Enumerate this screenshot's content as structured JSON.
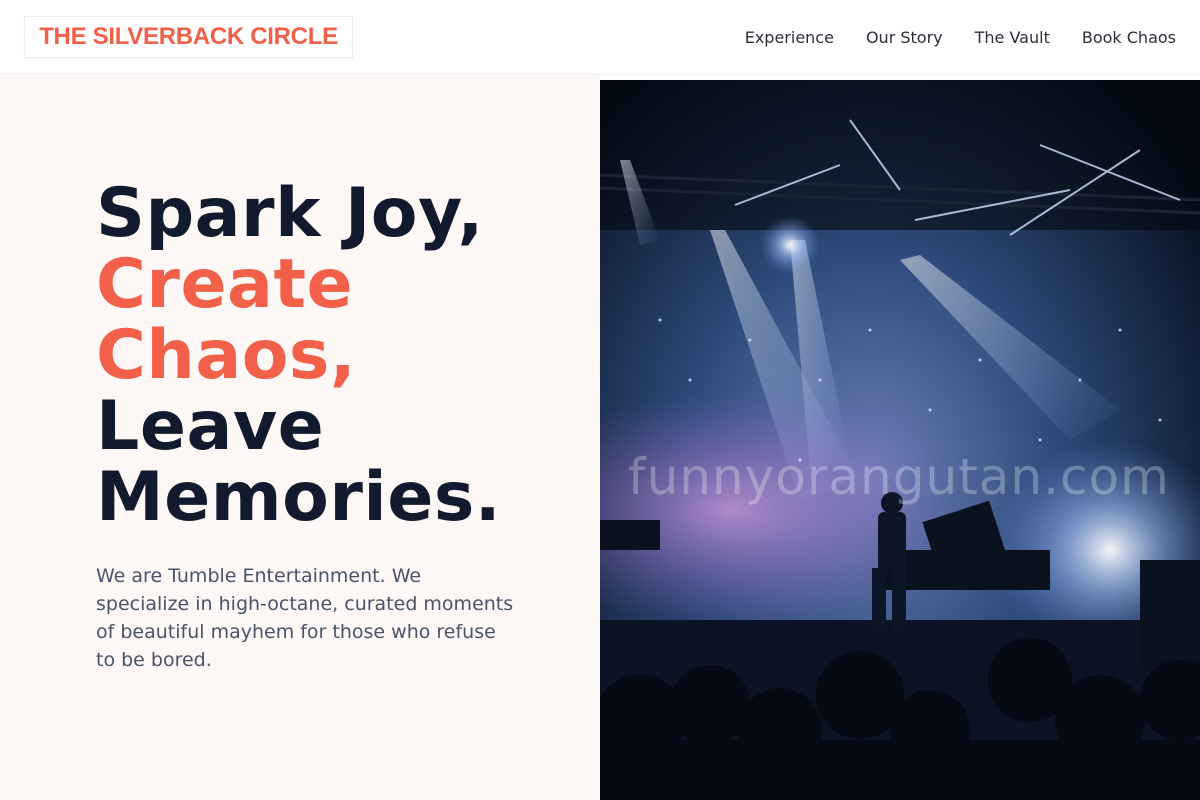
{
  "brand": {
    "logo_text": "THE SILVERBACK CIRCLE",
    "accent_color": "#f2604a"
  },
  "nav": {
    "items": [
      {
        "label": "Experience"
      },
      {
        "label": "Our Story"
      },
      {
        "label": "The Vault"
      },
      {
        "label": "Book Chaos"
      }
    ]
  },
  "hero": {
    "headline": {
      "line1": "Spark Joy,",
      "line2": "Create",
      "line3": "Chaos,",
      "line4": "Leave",
      "line5": "Memories."
    },
    "description": "We are Tumble Entertainment. We specialize in high-octane, curated moments of beautiful mayhem for those who refuse to be bored.",
    "image": {
      "subject": "concert-stage-photo",
      "watermark": "funnyorangutan.com"
    }
  },
  "colors": {
    "headline_dark": "#121a2e",
    "body_text": "#4a5469",
    "hero_bg": "#fdf7f6"
  }
}
